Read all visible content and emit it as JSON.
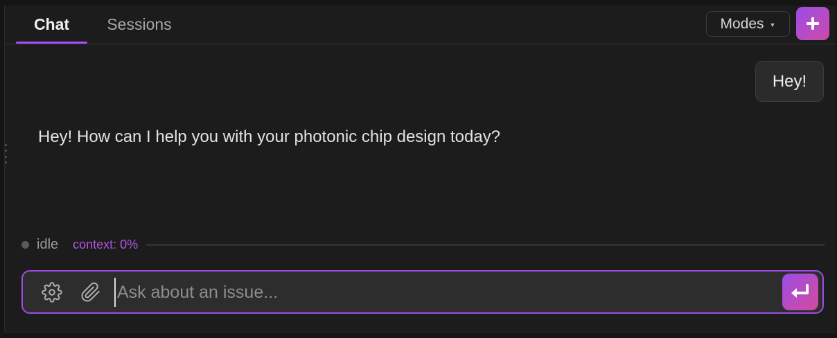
{
  "header": {
    "tabs": [
      {
        "label": "Chat",
        "active": true
      },
      {
        "label": "Sessions",
        "active": false
      }
    ],
    "modes_label": "Modes"
  },
  "messages": [
    {
      "role": "user",
      "text": "Hey!"
    },
    {
      "role": "assistant",
      "text": "Hey! How can I help you with your photonic chip design today?"
    }
  ],
  "status": {
    "state": "idle",
    "context_label": "context: 0%",
    "context_fraction": 0
  },
  "input": {
    "value": "",
    "placeholder": "Ask about an issue..."
  },
  "icons": {
    "new_chat": "plus-icon",
    "settings": "gear-icon",
    "attach": "paperclip-icon",
    "send": "enter-icon"
  },
  "colors": {
    "accent": "#a64dff",
    "accent_gradient_end": "#d44a9c",
    "context_text": "#b154e0"
  }
}
